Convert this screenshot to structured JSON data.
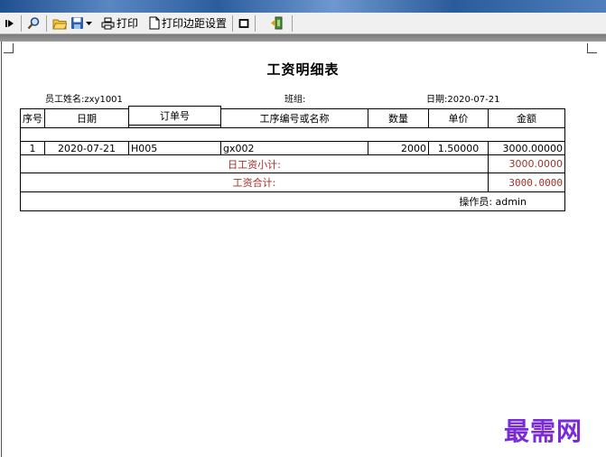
{
  "toolbar": {
    "print_label": "打印",
    "margin_label": "打印边距设置"
  },
  "report": {
    "title": "工资明细表",
    "employee": "员工姓名:zxy1001",
    "group": "班组:",
    "date": "日期:2020-07-21"
  },
  "table": {
    "headers": [
      "序号",
      "日期",
      "订单号",
      "工序编号或名称",
      "数量",
      "单价",
      "金额"
    ],
    "rows": [
      [
        "1",
        "2020-07-21",
        "H005",
        "gx002",
        "2000",
        "1.50000",
        "3000.00000"
      ]
    ],
    "daily_subtotal_label": "日工资小计:",
    "daily_subtotal_value": "3000.0000",
    "total_label": "工资合计:",
    "total_value": "3000.0000",
    "operator": "操作员: admin"
  },
  "watermark": "最需网"
}
